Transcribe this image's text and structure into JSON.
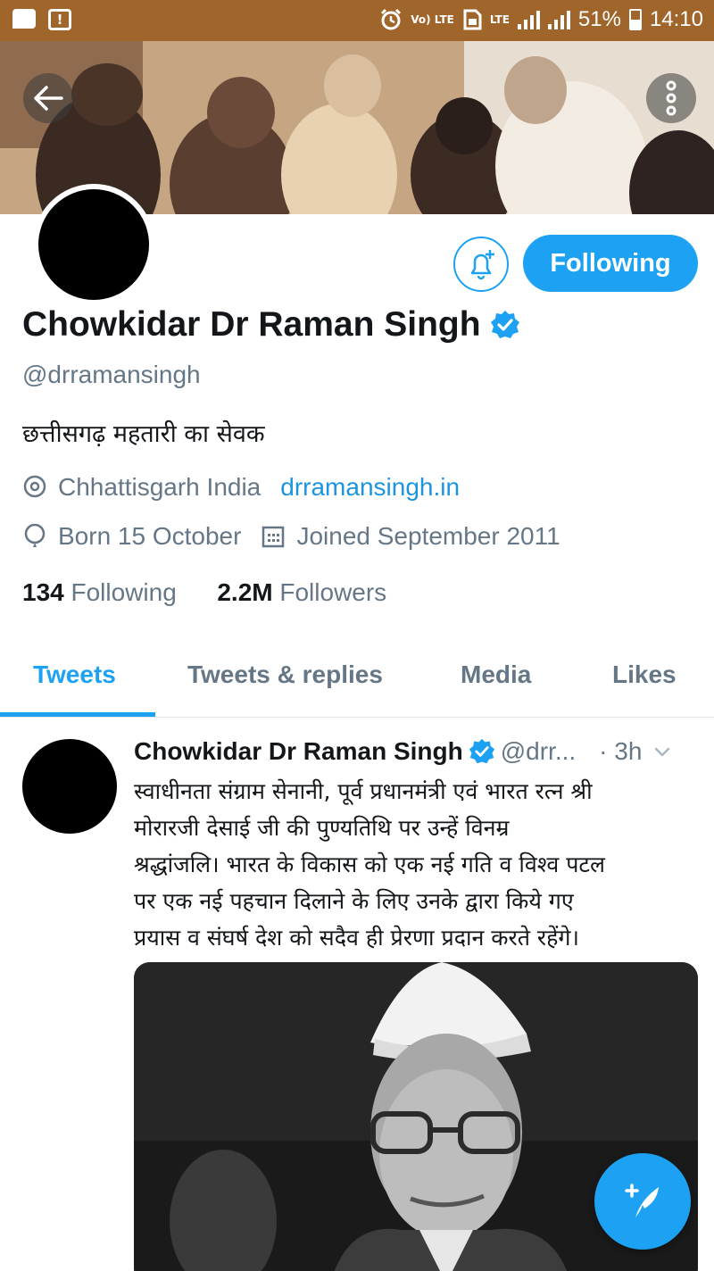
{
  "status_bar": {
    "battery": "51%",
    "time": "14:10",
    "volte": "Vo) LTE",
    "lte": "LTE"
  },
  "header": {
    "back_icon": "arrow-left-icon",
    "more_icon": "more-vertical-icon"
  },
  "profile": {
    "name": "Chowkidar Dr Raman Singh",
    "handle": "@drramansingh",
    "bio": "छत्तीसगढ़ महतारी का सेवक",
    "location": "Chhattisgarh India",
    "website": "drramansingh.in",
    "birthday": "Born 15 October",
    "joined": "Joined September 2011",
    "following_count": "134",
    "following_label": "Following",
    "followers_count": "2.2M",
    "followers_label": "Followers",
    "follow_button": "Following",
    "verified": true
  },
  "tabs": [
    {
      "label": "Tweets",
      "active": true
    },
    {
      "label": "Tweets & replies",
      "active": false
    },
    {
      "label": "Media",
      "active": false
    },
    {
      "label": "Likes",
      "active": false
    }
  ],
  "tweet": {
    "author": "Chowkidar Dr Raman Singh",
    "handle": "@drr...",
    "time": "· 3h",
    "lines": [
      "स्वाधीनता संग्राम सेनानी, पूर्व प्रधानमंत्री एवं भारत रत्न श्री",
      "मोरारजी देसाई जी की पुण्यतिथि पर उन्हें विनम्र",
      "श्रद्धांजलि। भारत के विकास को एक नई गति व विश्व पटल",
      "पर एक नई पहचान दिलाने के लिए उनके द्वारा किये गए",
      "प्रयास व संघर्ष देश को सदैव ही प्रेरणा प्रदान करते रहेंगे।"
    ]
  },
  "colors": {
    "accent": "#1da1f2",
    "status_bar": "#a0652a",
    "secondary_text": "#657786"
  }
}
